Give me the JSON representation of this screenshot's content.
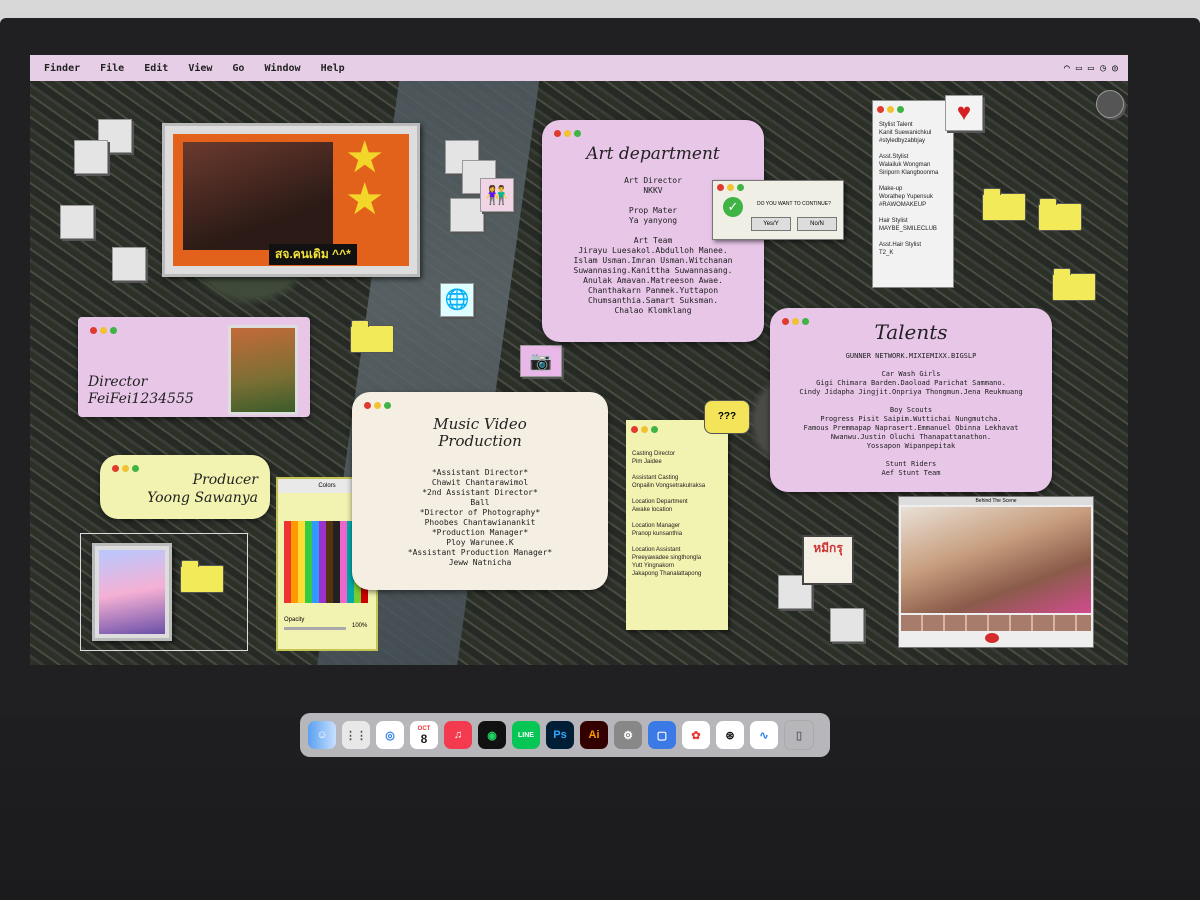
{
  "menubar": {
    "items": [
      "Finder",
      "File",
      "Edit",
      "View",
      "Go",
      "Window",
      "Help"
    ]
  },
  "photo_caption": "สจ.คนเดิม ^^*",
  "director": {
    "label": "Director",
    "name": "FeiFei1234555"
  },
  "producer": {
    "label": "Producer",
    "name": "Yoong Sawanya"
  },
  "art_department": {
    "title": "Art department",
    "lines": [
      "Art Director",
      "NKKV",
      "",
      "Prop Mater",
      "Ya yanyong",
      "",
      "Art Team",
      "Jirayu Luesakol.Abdulloh Manee.",
      "Islam Usman.Imran Usman.Witchanan",
      "Suwannasing.Kanittha Suwannasang.",
      "Anulak Amavan.Matreeson Awae.",
      "Chanthakarn Panmek.Yuttapon",
      "Chumsanthia.Samart Suksman.",
      "Chalao Klomklang"
    ]
  },
  "dialog": {
    "question": "DO YOU WANT TO CONTINUE?",
    "yes": "Yes/Y",
    "no": "No/N"
  },
  "stylist_note": {
    "lines": [
      "Stylist Talent",
      "Kanit Suewanichkul",
      "#styledbyzabbjay",
      "",
      "Asst.Stylist",
      "Walailuk Wongman",
      "Siriporn Klangboonma",
      "",
      "Make-up",
      "Worathep Yupensuk",
      "#RAWOMAKEUP",
      "",
      "Hair Stylist",
      "MAYBE_SMILECLUB",
      "",
      "Asst.Hair Stylist",
      "T2_K"
    ]
  },
  "talents": {
    "title": "Talents",
    "lines": [
      "GUNNER NETWORK.MIXIEMIXX.BIGSLP",
      "",
      "Car Wash Girls",
      "Gigi Chimara Barden.Daoload Parichat Sammano.",
      "Cindy Jidapha Jingjit.Onpriya Thongmun.Jena Reukmuang",
      "",
      "Boy Scouts",
      "Progress Pisit Saipim.Wuttichai Nungmutcha.",
      "Famous Premmapap Naprasert.Emmanuel Obinna Lekhavat",
      "Nwanwu.Justin Oluchi Thanapattanathon.",
      "Yossapon Wipanpepitak",
      "",
      "Stunt Riders",
      "Aef Stunt Team"
    ]
  },
  "music_video": {
    "title": "Music Video Production",
    "lines": [
      "*Assistant Director*",
      "Chawit Chantarawimol",
      "*2nd Assistant Director*",
      "Ball",
      "*Director of Photography*",
      "Phoobes Chantawianankit",
      "*Production Manager*",
      "Ploy Warunee.K",
      "*Assistant Production Manager*",
      "Jeww Natnicha"
    ]
  },
  "casting_note": {
    "lines": [
      "Casting Director",
      "Pim Jaidee",
      "",
      "Assistant Casting",
      "Onpailin Vongsetrakulraksa",
      "",
      "Location Department",
      "Awake location",
      "",
      "Location Manager",
      "Pranop kunsanthia",
      "",
      "Location Assistant",
      "Preeyawadee singthongla",
      "Yutt Yingnakorn",
      "Jakapong Thanalattapong"
    ]
  },
  "speech_bubble": "???",
  "colors_window": {
    "title": "Colors",
    "opacity_label": "Opacity",
    "opacity_value": "100%"
  },
  "bts_window": {
    "title": "Behind The Scene"
  },
  "sticker_text": "หมีกรุ",
  "dock": {
    "calendar_day": "8",
    "calendar_month": "OCT",
    "ps": "Ps",
    "ai": "Ai"
  },
  "colors": {
    "pink_window": "#e7c6e8",
    "note_yellow": "#f2f3b0",
    "cream_window": "#f4efe2",
    "orange_frame": "#e2621b"
  }
}
